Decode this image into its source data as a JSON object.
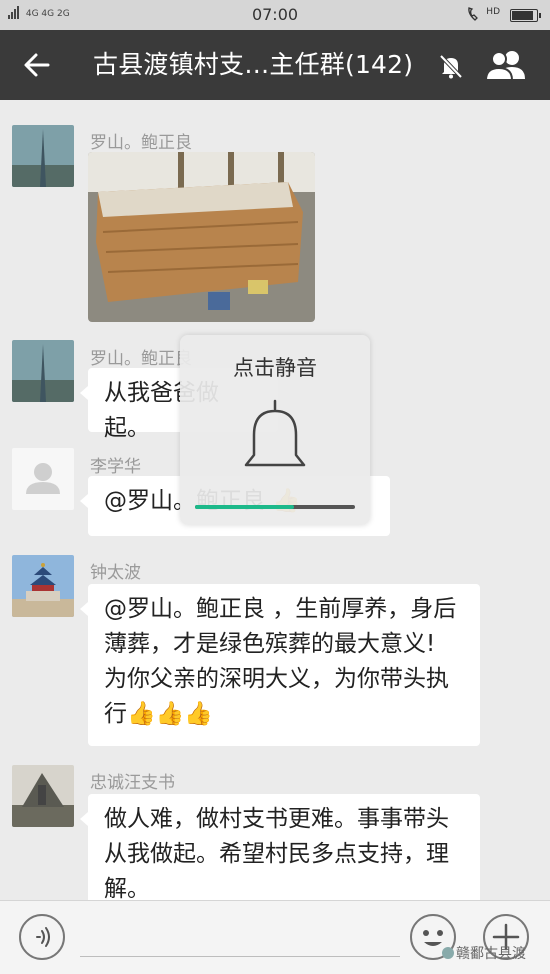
{
  "status_bar": {
    "network": "4G 4G 2G",
    "time": "07:00",
    "hd": "HD"
  },
  "header": {
    "title": "古县渡镇村支…主任群(142)",
    "icons": [
      "back-arrow-icon",
      "mute-bell-icon",
      "members-icon"
    ]
  },
  "messages": [
    {
      "sender": "罗山。鲍正良",
      "type": "image",
      "image_desc_icon": "photo-coffin"
    },
    {
      "sender": "罗山。鲍正良",
      "type": "text",
      "text": "从我爸爸做起。"
    },
    {
      "sender": "李学华",
      "type": "text",
      "text": "@罗山。鲍正良 👍"
    },
    {
      "sender": "钟太波",
      "type": "text",
      "lines": [
        "@罗山。鲍正良 ，生前厚养，身后",
        "薄葬，才是绿色殡葬的最大意义!",
        "为你父亲的深明大义，为你带头执",
        "行👍👍👍"
      ]
    },
    {
      "sender": "忠诚汪支书",
      "type": "text",
      "lines": [
        "做人难，做村支书更难。事事带头",
        "从我做起。希望村民多点支持，理",
        "解。"
      ]
    }
  ],
  "popup": {
    "label": "点击静音",
    "volume_level": 0.62,
    "accent_color": "#1db98a"
  },
  "input_bar": {
    "watermark": "赣鄱古县渡"
  }
}
